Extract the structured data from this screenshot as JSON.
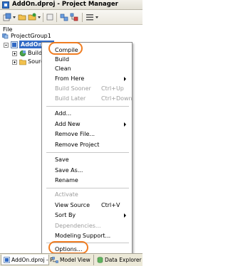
{
  "window": {
    "title": "AddOn.dproj - Project Manager"
  },
  "file_label": "File",
  "tree": {
    "group": "ProjectGroup1",
    "project": "AddOn.dproj",
    "project_visible": "AddOn.dp",
    "children": [
      {
        "label": "Build C"
      },
      {
        "label": "Sourc"
      }
    ]
  },
  "menu": {
    "items": [
      {
        "label": "Compile"
      },
      {
        "label": "Build"
      },
      {
        "label": "Clean"
      },
      {
        "label": "From Here"
      },
      {
        "label": "Build Sooner",
        "shortcut": "Ctrl+Up"
      },
      {
        "label": "Build Later",
        "shortcut": "Ctrl+Down"
      },
      {
        "label": "Add..."
      },
      {
        "label": "Add New"
      },
      {
        "label": "Remove File..."
      },
      {
        "label": "Remove Project"
      },
      {
        "label": "Save"
      },
      {
        "label": "Save As..."
      },
      {
        "label": "Rename"
      },
      {
        "label": "Activate"
      },
      {
        "label": "View Source",
        "shortcut": "Ctrl+V"
      },
      {
        "label": "Sort By"
      },
      {
        "label": "Dependencies..."
      },
      {
        "label": "Modeling Support..."
      },
      {
        "label": "Options..."
      }
    ]
  },
  "tabs": [
    {
      "label": "AddOn.dproj - P..."
    },
    {
      "label": "Model View"
    },
    {
      "label": "Data Explorer"
    }
  ],
  "colors": {
    "highlight": "#f07d22",
    "selection": "#316ac5"
  }
}
